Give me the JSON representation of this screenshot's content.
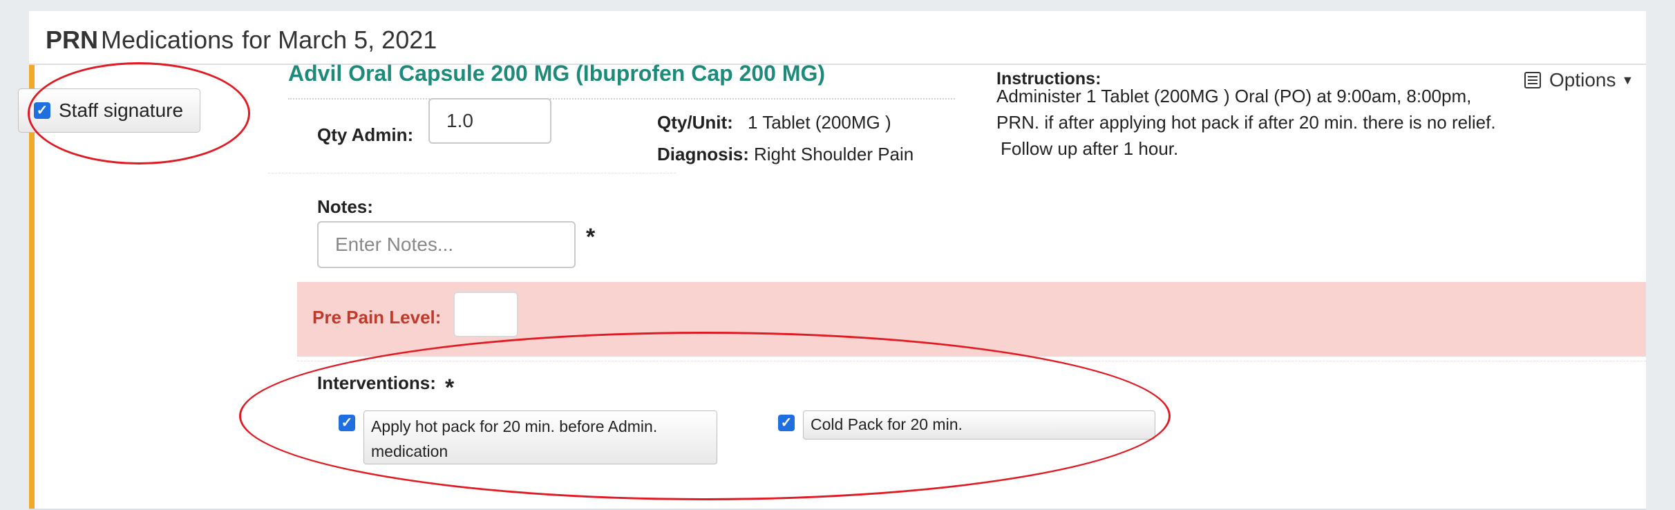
{
  "header": {
    "title_bold": "PRN",
    "title_main": "Medications",
    "title_date": "for March 5, 2021"
  },
  "signature": {
    "label": "Staff signature",
    "checked": true
  },
  "medication": {
    "name": "Advil Oral Capsule 200 MG (Ibuprofen Cap 200 MG)",
    "qty_admin_label": "Qty Admin:",
    "qty_admin_value": "1.0",
    "qty_unit_label": "Qty/Unit:",
    "qty_unit_value": "1 Tablet (200MG )",
    "diagnosis_label": "Diagnosis:",
    "diagnosis_value": "Right Shoulder Pain"
  },
  "instructions": {
    "label": "Instructions:",
    "line1": "Administer 1 Tablet (200MG ) Oral (PO) at 9:00am, 8:00pm,",
    "line2": "PRN. if after applying hot pack if after 20 min. there is no relief.",
    "line3": "Follow up after 1 hour."
  },
  "options": {
    "label": "Options"
  },
  "notes": {
    "label": "Notes:",
    "placeholder": "Enter Notes...",
    "required_mark": "*"
  },
  "pain": {
    "label": "Pre Pain Level:",
    "value": ""
  },
  "interventions": {
    "label": "Interventions:",
    "required_mark": "*",
    "items": [
      {
        "line1": "Apply hot pack for 20 min. before Admin.",
        "line2": "medication",
        "checked": true
      },
      {
        "line1": "Cold Pack for 20 min.",
        "checked": true
      }
    ]
  },
  "colors": {
    "accent_bar": "#f0a92b",
    "med_name": "#1d8a7a",
    "pain_band": "#f9d3cf",
    "pain_label": "#c0392b",
    "annotation": "#e01b24",
    "checkbox": "#1f6fe0"
  }
}
